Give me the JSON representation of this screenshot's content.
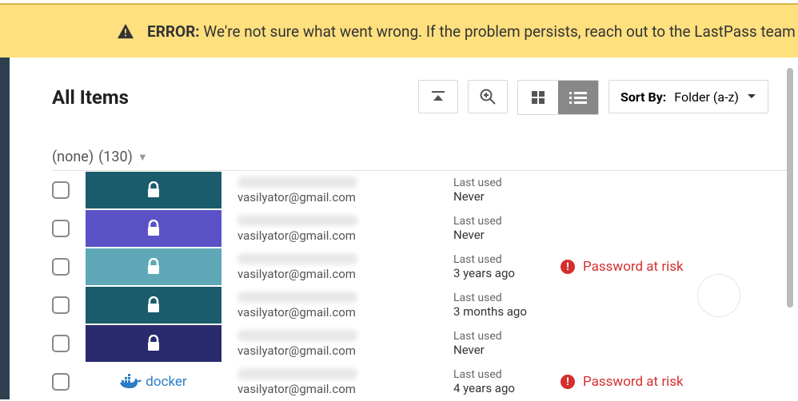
{
  "banner": {
    "prefix": "ERROR:",
    "text": "We're not sure what went wrong. If the problem persists, reach out to the LastPass team"
  },
  "page": {
    "title": "All Items"
  },
  "sort": {
    "label": "Sort By:",
    "value": "Folder (a-z)"
  },
  "group": {
    "name": "(none)",
    "count": "(130)"
  },
  "labels": {
    "last_used": "Last used",
    "at_risk": "Password at risk"
  },
  "items": [
    {
      "tile_color": "#1a5c6b",
      "email": "vasilyator@gmail.com",
      "last_used": "Never",
      "at_risk": false
    },
    {
      "tile_color": "#5b52c8",
      "email": "vasilyator@gmail.com",
      "last_used": "Never",
      "at_risk": false
    },
    {
      "tile_color": "#5fa8b8",
      "email": "vasilyator@gmail.com",
      "last_used": "3 years ago",
      "at_risk": true
    },
    {
      "tile_color": "#1a5c6b",
      "email": "vasilyator@gmail.com",
      "last_used": "3 months ago",
      "at_risk": false
    },
    {
      "tile_color": "#2a2a6e",
      "email": "vasilyator@gmail.com",
      "last_used": "Never",
      "at_risk": false
    },
    {
      "tile_color": "docker",
      "email": "vasilyator@gmail.com",
      "last_used": "4 years ago",
      "at_risk": true
    }
  ]
}
